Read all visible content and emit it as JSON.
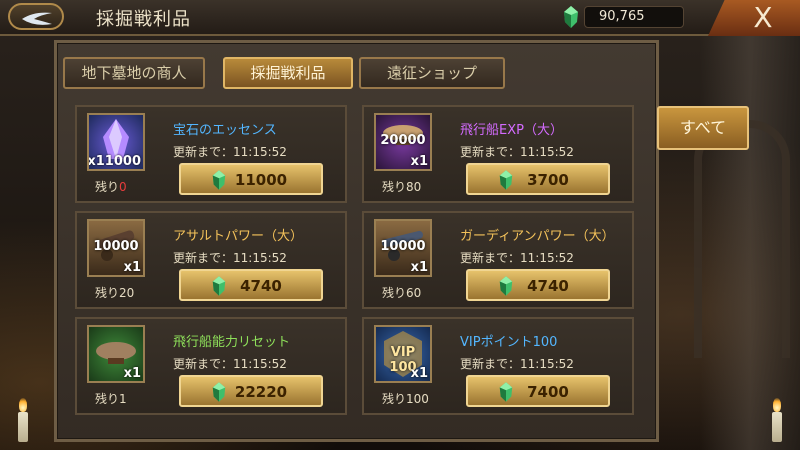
{
  "header": {
    "title": "採掘戦利品",
    "currency": "90,765",
    "close_label": "X"
  },
  "tabs": [
    {
      "label": "地下墓地の商人",
      "active": false
    },
    {
      "label": "採掘戦利品",
      "active": true
    },
    {
      "label": "遠征ショップ",
      "active": false
    }
  ],
  "all_button": "すべて",
  "items": [
    {
      "name": "宝石のエッセンス",
      "name_color": "#53b6ff",
      "thumb_qty": "x11000",
      "thumb_cap": "",
      "remain_label": "残り",
      "remain_value": "0",
      "update": "更新まで：11:15:52",
      "price": "11000"
    },
    {
      "name": "飛行船EXP（大）",
      "name_color": "#d46bff",
      "thumb_qty": "x1",
      "thumb_cap": "20000",
      "remain_label": "残り80",
      "remain_value": "",
      "update": "更新まで：11:15:52",
      "price": "3700"
    },
    {
      "name": "アサルトパワー（大）",
      "name_color": "#f3c25a",
      "thumb_qty": "x1",
      "thumb_cap": "10000",
      "remain_label": "残り20",
      "remain_value": "",
      "update": "更新まで：11:15:52",
      "price": "4740"
    },
    {
      "name": "ガーディアンパワー（大）",
      "name_color": "#f3c25a",
      "thumb_qty": "x1",
      "thumb_cap": "10000",
      "remain_label": "残り60",
      "remain_value": "",
      "update": "更新まで：11:15:52",
      "price": "4740"
    },
    {
      "name": "飛行船能力リセット",
      "name_color": "#8ee05a",
      "thumb_qty": "x1",
      "thumb_cap": "",
      "remain_label": "残り1",
      "remain_value": "",
      "update": "更新まで：11:15:52",
      "price": "22220"
    },
    {
      "name": "VIPポイント100",
      "name_color": "#53b6ff",
      "thumb_qty": "x1",
      "thumb_cap": "VIP 100",
      "remain_label": "残り100",
      "remain_value": "",
      "update": "更新まで：11:15:52",
      "price": "7400"
    }
  ]
}
